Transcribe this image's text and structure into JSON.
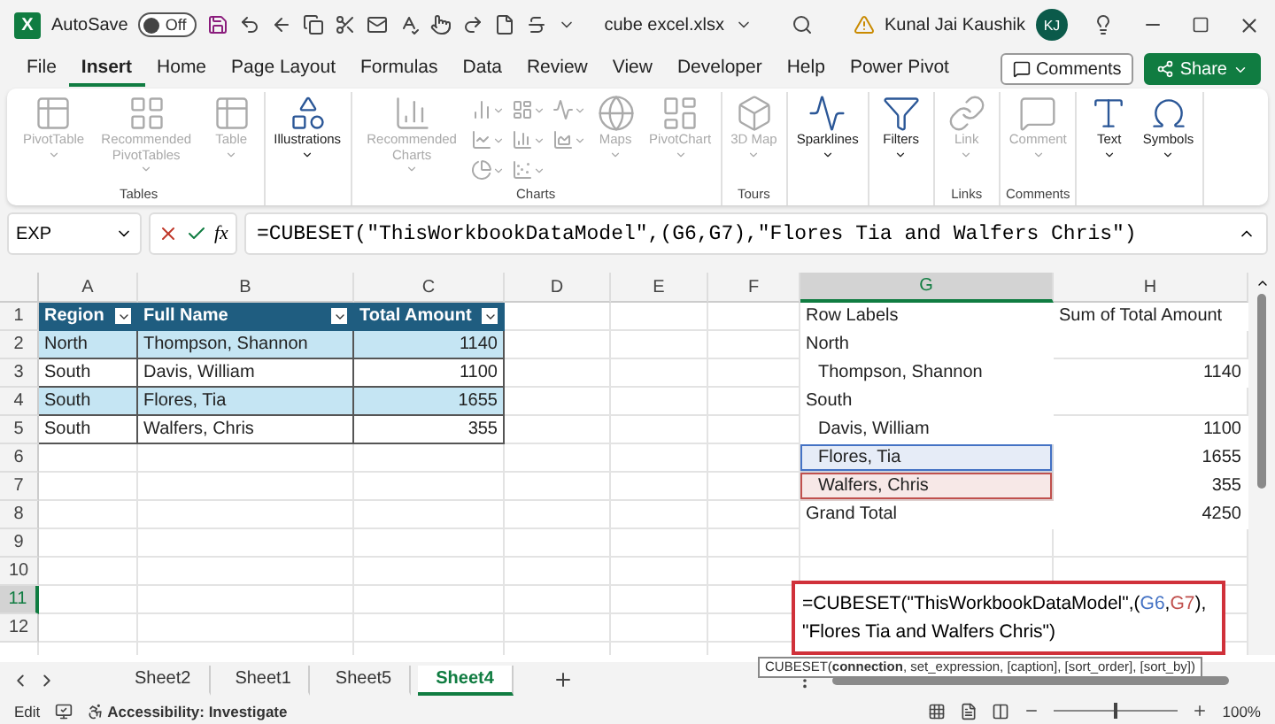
{
  "title_bar": {
    "logo": "X",
    "autosave_label": "AutoSave",
    "autosave": {
      "on": false,
      "label": "Off"
    },
    "file_name": "cube excel.xlsx",
    "user_name": "Kunal Jai Kaushik",
    "avatar_initials": "KJ"
  },
  "menu": {
    "tabs": [
      {
        "label": "File",
        "selected": false
      },
      {
        "label": "Insert",
        "selected": true
      },
      {
        "label": "Home",
        "selected": false
      },
      {
        "label": "Page Layout",
        "selected": false
      },
      {
        "label": "Formulas",
        "selected": false
      },
      {
        "label": "Data",
        "selected": false
      },
      {
        "label": "Review",
        "selected": false
      },
      {
        "label": "View",
        "selected": false
      },
      {
        "label": "Developer",
        "selected": false
      },
      {
        "label": "Help",
        "selected": false
      },
      {
        "label": "Power Pivot",
        "selected": false
      }
    ],
    "comments_button": "Comments",
    "share_button": "Share"
  },
  "ribbon": {
    "groups": [
      {
        "label": "Tables",
        "items": [
          {
            "kind": "large",
            "label": "PivotTable",
            "disabled": true
          },
          {
            "kind": "large",
            "label": "Recommended PivotTables",
            "disabled": true
          },
          {
            "kind": "large",
            "label": "Table",
            "disabled": true
          }
        ]
      },
      {
        "items": [
          {
            "kind": "large",
            "label": "Illustrations",
            "disabled": false
          }
        ]
      },
      {
        "label": "Charts",
        "items": [
          {
            "kind": "large",
            "label": "Recommended Charts",
            "disabled": true
          },
          {
            "kind": "small",
            "disabled": true
          },
          {
            "kind": "small",
            "disabled": true
          },
          {
            "kind": "small",
            "disabled": true
          },
          {
            "kind": "small",
            "disabled": true
          },
          {
            "kind": "small",
            "disabled": true
          },
          {
            "kind": "small",
            "disabled": true
          },
          {
            "kind": "small",
            "disabled": true
          },
          {
            "kind": "small",
            "disabled": true
          },
          {
            "kind": "large",
            "label": "Maps",
            "disabled": true
          },
          {
            "kind": "large",
            "label": "PivotChart",
            "disabled": true
          }
        ]
      },
      {
        "label": "Tours",
        "items": [
          {
            "kind": "large",
            "label": "3D Map",
            "disabled": true
          }
        ]
      },
      {
        "items": [
          {
            "kind": "large",
            "label": "Sparklines",
            "disabled": false
          }
        ]
      },
      {
        "items": [
          {
            "kind": "large",
            "label": "Filters",
            "disabled": false
          }
        ]
      },
      {
        "label": "Links",
        "items": [
          {
            "kind": "large",
            "label": "Link",
            "disabled": true
          }
        ]
      },
      {
        "label": "Comments",
        "items": [
          {
            "kind": "large",
            "label": "Comment",
            "disabled": true
          }
        ]
      },
      {
        "items": [
          {
            "kind": "large",
            "label": "Text",
            "disabled": false
          },
          {
            "kind": "large",
            "label": "Symbols",
            "disabled": false
          }
        ]
      }
    ]
  },
  "formula_bar": {
    "name_box": "EXP",
    "function_label": "fx",
    "formula": "=CUBESET(\"ThisWorkbookDataModel\",(G6,G7),\"Flores Tia and Walfers Chris\")"
  },
  "grid": {
    "columns": [
      {
        "label": "A",
        "selected": false
      },
      {
        "label": "B",
        "selected": false
      },
      {
        "label": "C",
        "selected": false
      },
      {
        "label": "D",
        "selected": false
      },
      {
        "label": "E",
        "selected": false
      },
      {
        "label": "F",
        "selected": false
      },
      {
        "label": "G",
        "selected": true
      },
      {
        "label": "H",
        "selected": false
      }
    ],
    "rows": [
      {
        "number": "1",
        "selected": false,
        "cells": {
          "A": {
            "kind": "table-header",
            "text": "Region"
          },
          "B": {
            "kind": "table-header",
            "text": "Full Name"
          },
          "C": {
            "kind": "table-header",
            "text": "Total Amount"
          },
          "G": {
            "kind": "pivot-label",
            "text": "Row Labels"
          },
          "H": {
            "kind": "pivot-label",
            "text": "Sum of Total Amount"
          }
        }
      },
      {
        "number": "2",
        "selected": false,
        "cells": {
          "A": {
            "kind": "table-text",
            "banded": true,
            "text": "North"
          },
          "B": {
            "kind": "table-text",
            "banded": true,
            "text": "Thompson, Shannon"
          },
          "C": {
            "kind": "table-number",
            "banded": true,
            "text": "1140"
          },
          "G": {
            "kind": "pivot-label",
            "text": "North"
          }
        }
      },
      {
        "number": "3",
        "selected": false,
        "cells": {
          "A": {
            "kind": "table-text",
            "banded": false,
            "text": "South"
          },
          "B": {
            "kind": "table-text",
            "banded": false,
            "text": "Davis, William"
          },
          "C": {
            "kind": "table-number",
            "banded": false,
            "text": "1100"
          },
          "G": {
            "kind": "pivot-item",
            "text": "Thompson, Shannon"
          },
          "H": {
            "kind": "pivot-value",
            "text": "1140"
          }
        }
      },
      {
        "number": "4",
        "selected": false,
        "cells": {
          "A": {
            "kind": "table-text",
            "banded": true,
            "text": "South"
          },
          "B": {
            "kind": "table-text",
            "banded": true,
            "text": "Flores, Tia"
          },
          "C": {
            "kind": "table-number",
            "banded": true,
            "text": "1655"
          },
          "G": {
            "kind": "pivot-label",
            "text": "South"
          }
        }
      },
      {
        "number": "5",
        "selected": false,
        "cells": {
          "A": {
            "kind": "table-text",
            "banded": false,
            "text": "South"
          },
          "B": {
            "kind": "table-text",
            "banded": false,
            "text": "Walfers, Chris"
          },
          "C": {
            "kind": "table-number",
            "banded": false,
            "text": "355"
          },
          "G": {
            "kind": "pivot-item",
            "text": "Davis, William"
          },
          "H": {
            "kind": "pivot-value",
            "text": "1100"
          }
        }
      },
      {
        "number": "6",
        "selected": false,
        "cells": {
          "G": {
            "kind": "pivot-item",
            "text": "Flores, Tia",
            "color": "#4472c4"
          },
          "H": {
            "kind": "pivot-value",
            "text": "1655"
          }
        }
      },
      {
        "number": "7",
        "selected": false,
        "cells": {
          "G": {
            "kind": "pivot-item",
            "text": "Walfers, Chris",
            "color": "#c0504d"
          },
          "H": {
            "kind": "pivot-value",
            "text": "355"
          }
        }
      },
      {
        "number": "8",
        "selected": false,
        "cells": {
          "G": {
            "kind": "pivot-label",
            "text": "Grand Total"
          },
          "H": {
            "kind": "pivot-value",
            "text": "4250"
          }
        }
      },
      {
        "number": "9",
        "selected": false,
        "cells": {}
      },
      {
        "number": "10",
        "selected": false,
        "cells": {}
      },
      {
        "number": "11",
        "selected": true,
        "cells": {}
      },
      {
        "number": "12",
        "selected": false,
        "cells": {}
      }
    ],
    "cell_editor": {
      "lines": [
        [
          {
            "kind": "plain",
            "text": "=CUBESET(\"ThisWorkbookDataModel\",("
          },
          {
            "kind": "ref",
            "text": "G6",
            "color": "#4472c4"
          },
          {
            "kind": "plain",
            "text": ","
          },
          {
            "kind": "ref",
            "text": "G7",
            "color": "#c0504d"
          },
          {
            "kind": "plain",
            "text": "),"
          }
        ],
        [
          {
            "kind": "plain",
            "text": "\"Flores Tia and Walfers Chris\")"
          }
        ]
      ],
      "tooltip": "CUBESET(**connection**, set_expression, [caption], [sort_order], [sort_by])"
    }
  },
  "sheet_tabs": [
    {
      "label": "Sheet2",
      "selected": false
    },
    {
      "label": "Sheet1",
      "selected": false
    },
    {
      "label": "Sheet5",
      "selected": false
    },
    {
      "label": "Sheet4",
      "selected": true
    }
  ],
  "status_bar": {
    "mode": "Edit",
    "accessibility": "Accessibility: Investigate",
    "zoom": {
      "level": 0.5,
      "label": "100%"
    }
  }
}
